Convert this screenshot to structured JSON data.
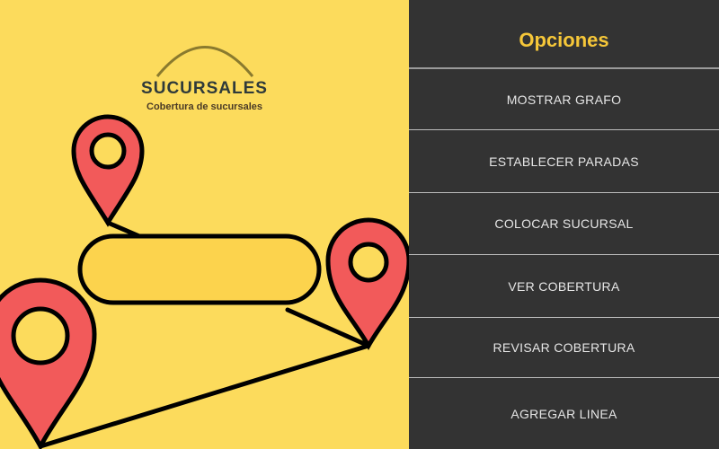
{
  "logo": {
    "title": "SUCURSALES",
    "subtitle": "Cobertura de sucursales"
  },
  "panel": {
    "title": "Opciones",
    "options": [
      {
        "label": "MOSTRAR GRAFO"
      },
      {
        "label": "ESTABLECER PARADAS"
      },
      {
        "label": "COLOCAR SUCURSAL"
      },
      {
        "label": "VER COBERTURA"
      },
      {
        "label": "REVISAR COBERTURA"
      },
      {
        "label": "AGREGAR LINEA"
      }
    ]
  },
  "colors": {
    "background": "#fcdb5c",
    "panel": "#333333",
    "accent": "#f6c739",
    "pin": "#f25a5a"
  }
}
